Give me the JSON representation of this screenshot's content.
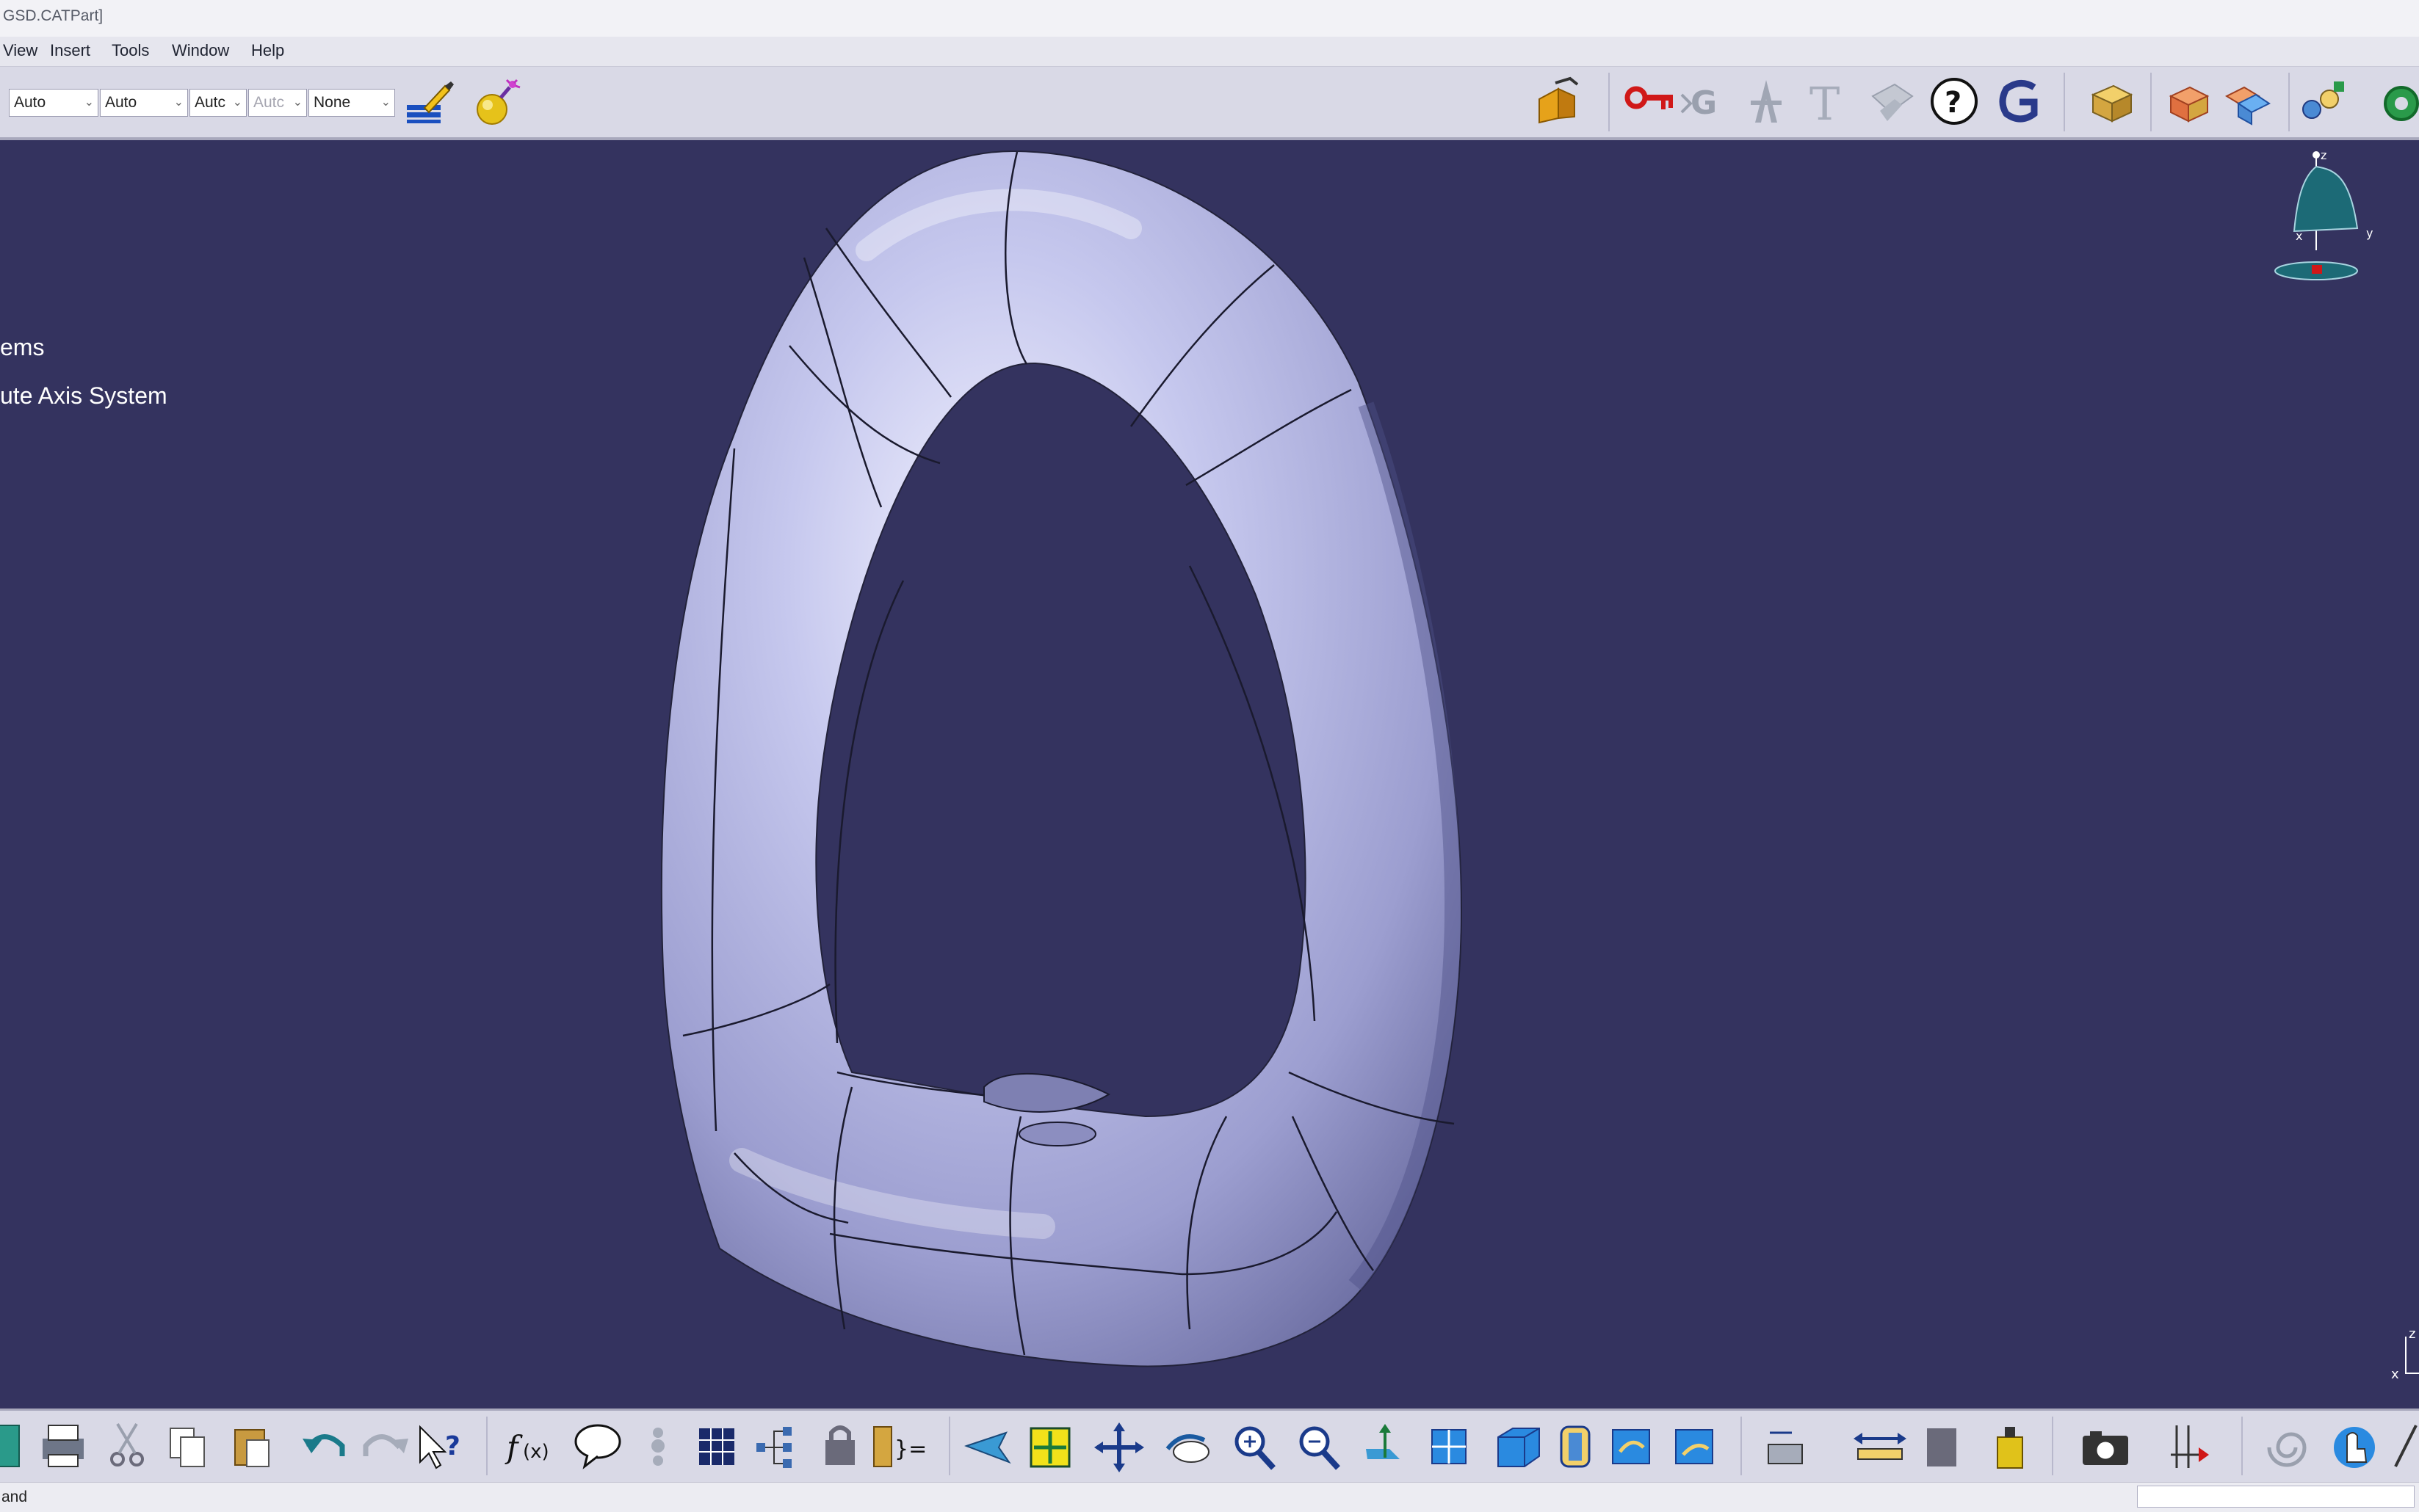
{
  "window": {
    "title": "GSD.CATPart]"
  },
  "menu": [
    {
      "id": "view",
      "label": "View"
    },
    {
      "id": "insert",
      "label": "Insert"
    },
    {
      "id": "tools",
      "label": "Tools"
    },
    {
      "id": "window",
      "label": "Window"
    },
    {
      "id": "help",
      "label": "Help"
    }
  ],
  "graphic_properties": {
    "combo1": "Auto",
    "combo2": "Auto",
    "combo3": "Autc",
    "combo4": "Autc",
    "combo5": "None"
  },
  "tree": {
    "item1": "ems",
    "item2": "ute Axis System"
  },
  "compass": {
    "x": "x",
    "y": "y",
    "z": "z"
  },
  "mini_axis": {
    "x": "x",
    "z": "z"
  },
  "toolbar_top": {
    "icons": [
      "paint-brush-icon",
      "bomb-icon",
      "copy-object-icon",
      "key-icon",
      "g-formula-icon",
      "stamp-icon",
      "text-icon",
      "note-icon",
      "help-icon",
      "g-logo-icon",
      "cube-icon"
    ]
  },
  "toolbar_bottom": {
    "icons": [
      "save-icon",
      "print-icon",
      "cut-icon",
      "copy-icon",
      "paste-icon",
      "undo-icon",
      "redo-icon",
      "whats-this-icon",
      "formula-icon",
      "knowledge-icon",
      "table-icon",
      "tree-icon",
      "lock-icon",
      "parameters-icon",
      "fly-icon",
      "fit-all-icon",
      "pan-icon",
      "rotate-icon",
      "zoom-in-icon",
      "zoom-out-icon",
      "normal-view-icon",
      "multi-view-icon",
      "iso-view-icon",
      "render-style-icon",
      "hide-show-icon",
      "swap-icon",
      "measure-between-icon",
      "measure-item-icon",
      "mass-icon",
      "camera-icon",
      "ruler-icon",
      "spiral-icon",
      "touch-icon"
    ]
  },
  "status": {
    "text": "and"
  },
  "colors": {
    "viewport_bg": "#34335f",
    "toolbar_bg": "#d9d9e6",
    "part_surface": "#b6b8e2"
  }
}
